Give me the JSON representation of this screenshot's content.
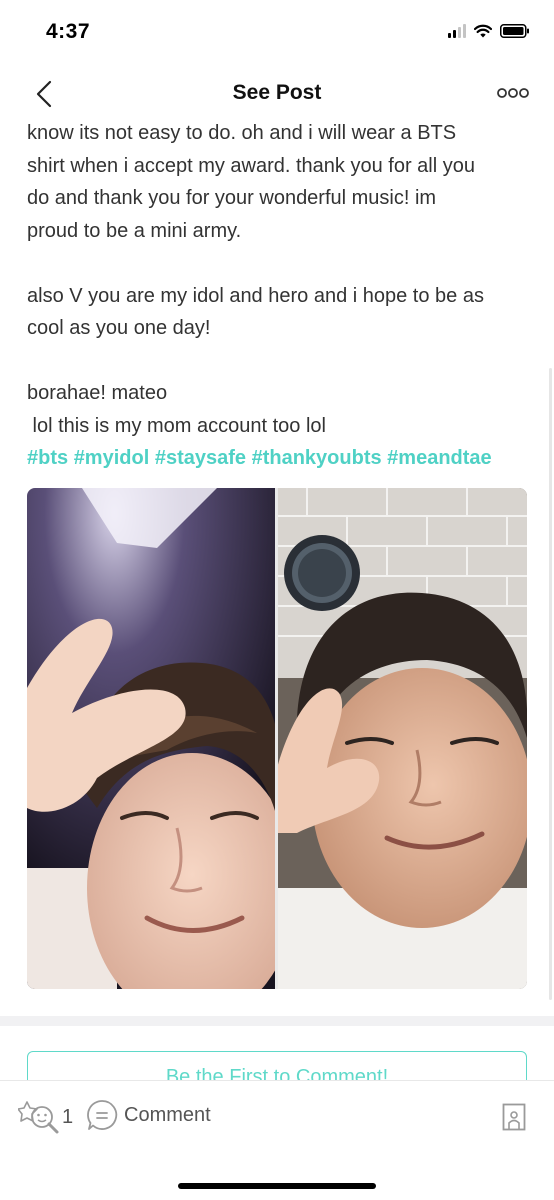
{
  "status_bar": {
    "time": "4:37"
  },
  "nav": {
    "title": "See Post",
    "back_icon": "chevron-left-icon",
    "more_icon": "more-horizontal-icon"
  },
  "post": {
    "paragraph_1_lines": [
      "know its not easy to do. oh and i will wear a BTS",
      "shirt when i accept my award. thank you for all you",
      "do and thank you for your wonderful music! im",
      "proud to be a mini army."
    ],
    "paragraph_2_lines": [
      "also V you are my idol and hero and i hope to be as",
      "cool as you one day!"
    ],
    "signoff": "borahae! mateo",
    "note": " lol this is my mom account too lol",
    "hashtags": [
      "#bts",
      "#myidol",
      "#staysafe",
      "#thankyoubts",
      "#meandtae"
    ],
    "link_color": "#4fd1c5"
  },
  "comment_prompt": "Be the First to Comment!",
  "actions": {
    "like_count": "1",
    "comment_label": "Comment",
    "accent_color": "#5fd9c9"
  }
}
